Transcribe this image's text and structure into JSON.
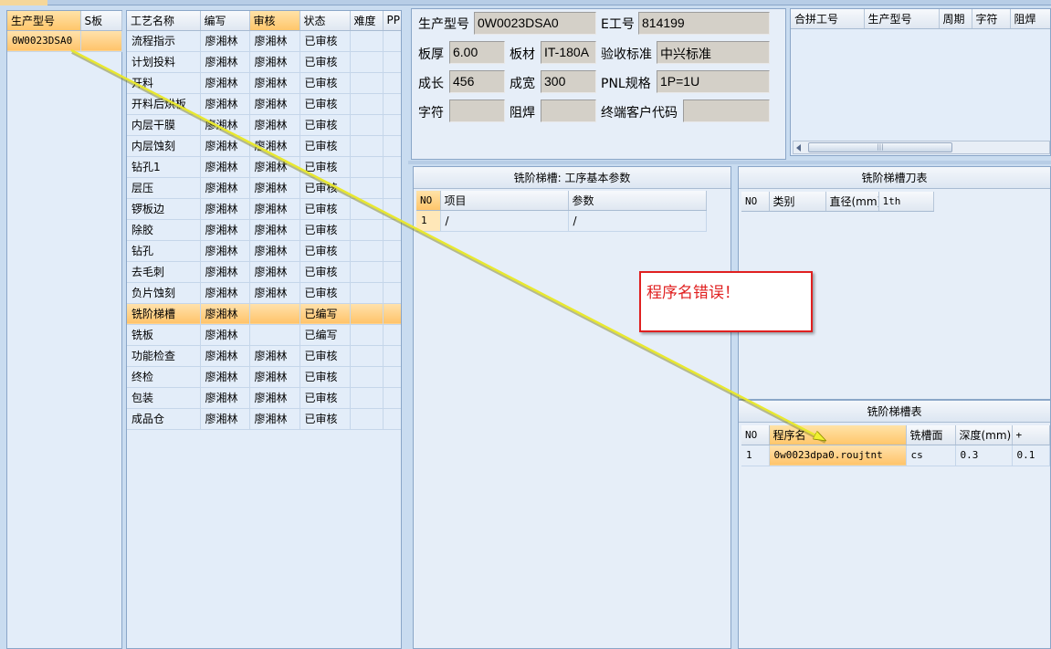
{
  "left_list": {
    "headers": [
      "生产型号",
      "S板"
    ],
    "rows": [
      [
        "0W0023DSA0",
        ""
      ]
    ]
  },
  "process": {
    "headers": [
      "工艺名称",
      "编写",
      "审核",
      "状态",
      "难度",
      "PP"
    ],
    "rows": [
      [
        "流程指示",
        "廖湘林",
        "廖湘林",
        "已审核"
      ],
      [
        "计划投料",
        "廖湘林",
        "廖湘林",
        "已审核"
      ],
      [
        "开料",
        "廖湘林",
        "廖湘林",
        "已审核"
      ],
      [
        "开料后烘板",
        "廖湘林",
        "廖湘林",
        "已审核"
      ],
      [
        "内层干膜",
        "廖湘林",
        "廖湘林",
        "已审核"
      ],
      [
        "内层蚀刻",
        "廖湘林",
        "廖湘林",
        "已审核"
      ],
      [
        "钻孔1",
        "廖湘林",
        "廖湘林",
        "已审核"
      ],
      [
        "层压",
        "廖湘林",
        "廖湘林",
        "已审核"
      ],
      [
        "锣板边",
        "廖湘林",
        "廖湘林",
        "已审核"
      ],
      [
        "除胶",
        "廖湘林",
        "廖湘林",
        "已审核"
      ],
      [
        "钻孔",
        "廖湘林",
        "廖湘林",
        "已审核"
      ],
      [
        "去毛刺",
        "廖湘林",
        "廖湘林",
        "已审核"
      ],
      [
        "负片蚀刻",
        "廖湘林",
        "廖湘林",
        "已审核"
      ],
      [
        "铣阶梯槽",
        "廖湘林",
        "",
        "已编写"
      ],
      [
        "铣板",
        "廖湘林",
        "",
        "已编写"
      ],
      [
        "功能检查",
        "廖湘林",
        "廖湘林",
        "已审核"
      ],
      [
        "终检",
        "廖湘林",
        "廖湘林",
        "已审核"
      ],
      [
        "包装",
        "廖湘林",
        "廖湘林",
        "已审核"
      ],
      [
        "成品仓",
        "廖湘林",
        "廖湘林",
        "已审核"
      ]
    ]
  },
  "info": {
    "prod_model_label": "生产型号",
    "prod_model": "0W0023DSA0",
    "e_no_label": "E工号",
    "e_no": "814199",
    "thickness_label": "板厚",
    "thickness": "6.00",
    "material_label": "板材",
    "material": "IT-180A",
    "standard_label": "验收标准",
    "standard": "中兴标准",
    "length_label": "成长",
    "length": "456",
    "width_label": "成宽",
    "width": "300",
    "pnl_label": "PNL规格",
    "pnl": "1P=1U",
    "char_label": "字符",
    "char": "",
    "mask_label": "阻焊",
    "mask": "",
    "customer_label": "终端客户代码",
    "customer": ""
  },
  "combine": {
    "headers": [
      "合拼工号",
      "生产型号",
      "周期",
      "字符",
      "阻焊"
    ]
  },
  "params": {
    "title": "铣阶梯槽: 工序基本参数",
    "headers": [
      "NO",
      "项目",
      "参数"
    ],
    "rows": [
      [
        "1",
        "/",
        "/"
      ]
    ]
  },
  "tools": {
    "title": "铣阶梯槽刀表",
    "headers": [
      "NO",
      "类别",
      "直径(mm)",
      "1th"
    ]
  },
  "slots": {
    "title": "铣阶梯槽表",
    "headers": [
      "NO",
      "程序名",
      "铣槽面",
      "深度(mm)",
      "+"
    ],
    "rows": [
      [
        "1",
        "0w0023dpa0.roujtnt",
        "cs",
        "0.3",
        "0.1"
      ]
    ]
  },
  "annotation": {
    "text": "程序名错误！",
    "color": "#e02020",
    "arrow_color": "#e8e830"
  }
}
